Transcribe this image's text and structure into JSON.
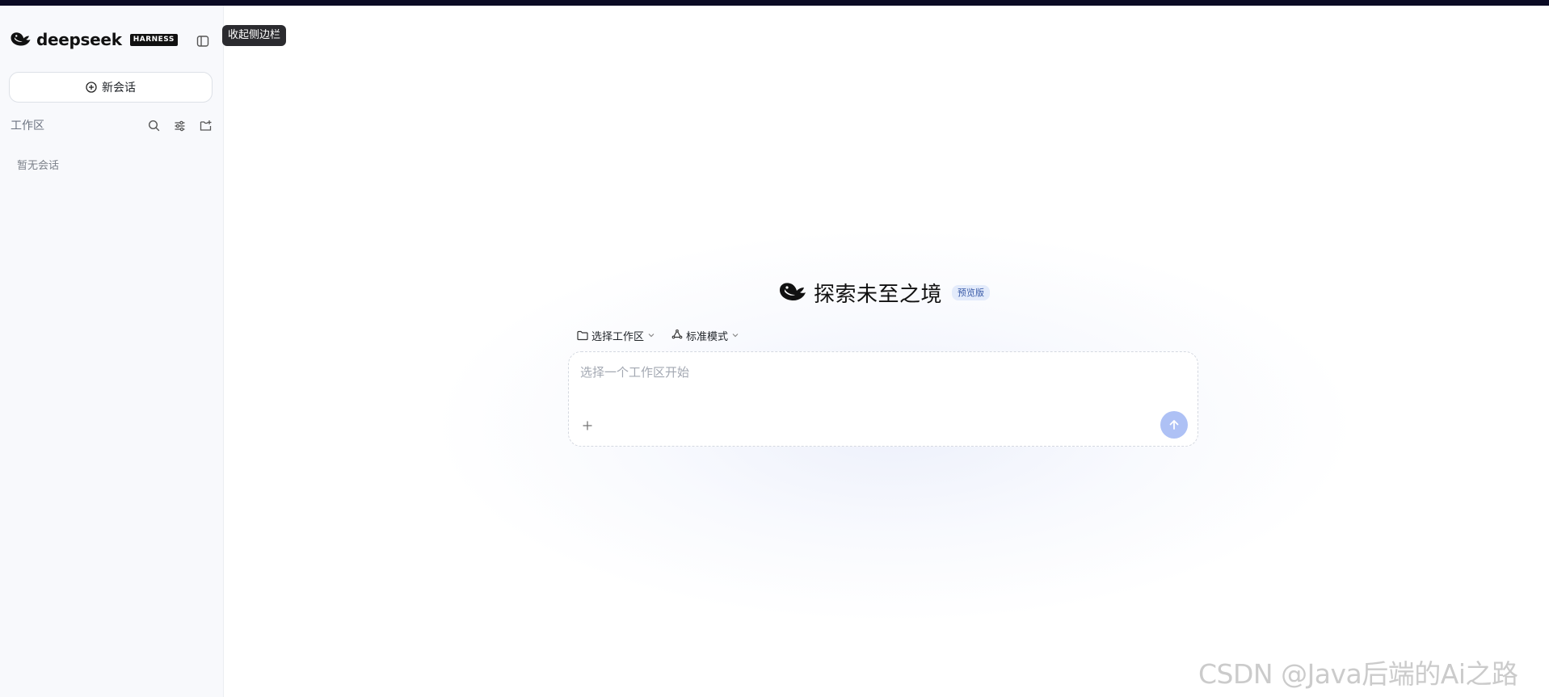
{
  "sidebar": {
    "brand": {
      "name": "deepseek",
      "badge": "HARNESS",
      "logo_icon": "whale-logo-icon"
    },
    "collapse_tooltip": "收起侧边栏",
    "new_chat_label": "新会话",
    "workspace": {
      "title": "工作区",
      "actions": [
        "search-icon",
        "filter-icon",
        "new-folder-icon"
      ]
    },
    "empty_text": "暂无会话"
  },
  "main": {
    "hero": {
      "title": "探索未至之境",
      "badge": "预览版"
    },
    "toolbar": {
      "workspace_select": "选择工作区",
      "mode_select": "标准模式"
    },
    "composer": {
      "placeholder": "选择一个工作区开始",
      "value": ""
    }
  },
  "watermark": "CSDN @Java后端的Ai之路",
  "colors": {
    "top_bar": "#0b0b24",
    "sidebar_bg": "#f8f9fc",
    "send_button": "#aec1f5",
    "badge_bg": "#e3ebfb",
    "tooltip_bg": "#2b2b2f"
  }
}
